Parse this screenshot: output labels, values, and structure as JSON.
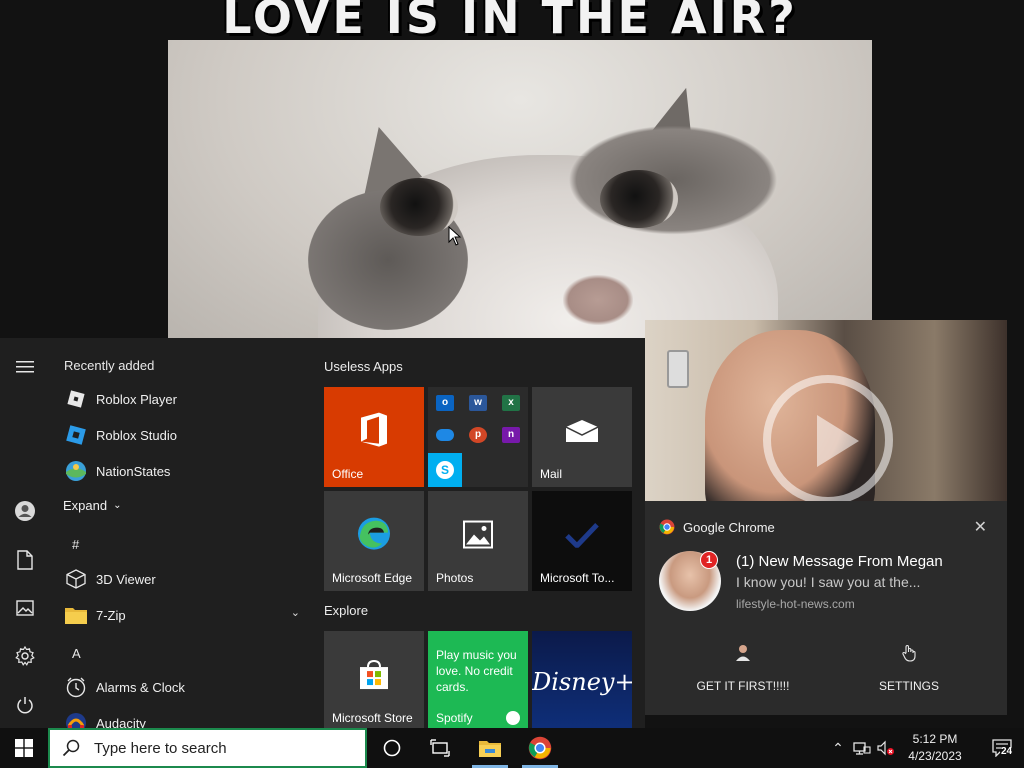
{
  "wallpaper": {
    "caption": "LOVE IS IN THE AIR?"
  },
  "start_menu": {
    "recently_added_title": "Recently added",
    "recent_apps": [
      {
        "label": "Roblox Player",
        "icon": "roblox-icon"
      },
      {
        "label": "Roblox Studio",
        "icon": "roblox-studio-icon"
      },
      {
        "label": "NationStates",
        "icon": "nationstates-icon"
      }
    ],
    "expand_label": "Expand",
    "letter_hash": "#",
    "hash_apps": [
      {
        "label": "3D Viewer",
        "icon": "cube-icon"
      },
      {
        "label": "7-Zip",
        "icon": "folder-icon"
      }
    ],
    "letter_a": "A",
    "a_apps": [
      {
        "label": "Alarms & Clock",
        "icon": "alarm-icon"
      },
      {
        "label": "Audacity",
        "icon": "audacity-icon"
      }
    ],
    "tile_groups": [
      {
        "title": "Useless Apps",
        "tiles": [
          {
            "label": "Office",
            "color": "#d83b01"
          },
          {
            "label": "",
            "color": "#2b2b2b"
          },
          {
            "label": "Mail",
            "color": "#3a3a3a"
          },
          {
            "label": "Microsoft Edge",
            "color": "#3a3a3a"
          },
          {
            "label": "Photos",
            "color": "#3a3a3a"
          },
          {
            "label": "Microsoft To...",
            "color": "#0d0d0d"
          }
        ]
      },
      {
        "title": "Explore",
        "tiles": [
          {
            "label": "Microsoft Store",
            "color": "#3a3a3a"
          },
          {
            "label": "Spotify",
            "color": "#1db954",
            "promo": "Play music you love. No credit cards."
          },
          {
            "label": "",
            "color": "#0b1a4a",
            "brand": "Disney+"
          }
        ]
      }
    ]
  },
  "toast": {
    "app_name": "Google Chrome",
    "title": "(1) New Message From Megan",
    "body": "I know you! I saw you at the...",
    "site": "lifestyle-hot-news.com",
    "badge": "1",
    "actions": [
      {
        "label": "GET IT FIRST!!!!!",
        "icon": "avatar-icon"
      },
      {
        "label": "SETTINGS",
        "icon": "gear-icon"
      }
    ]
  },
  "taskbar": {
    "search_placeholder": "Type here to search",
    "time": "5:12 PM",
    "date": "4/23/2023",
    "notification_count": "24"
  }
}
